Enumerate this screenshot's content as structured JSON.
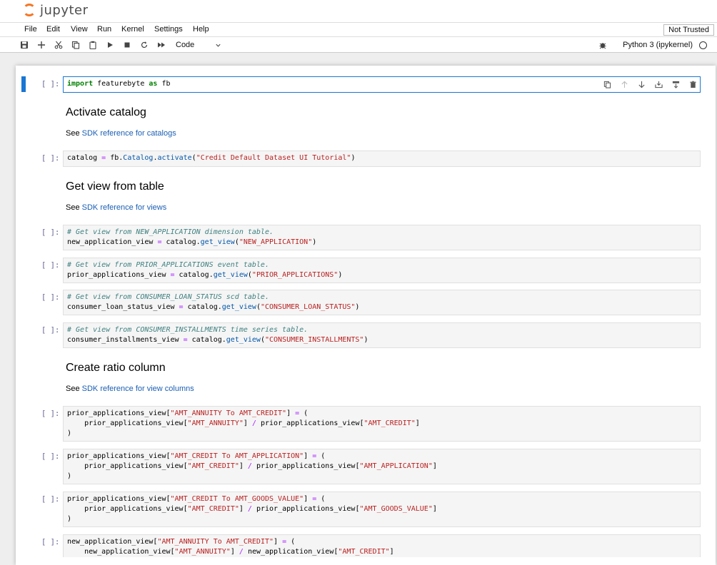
{
  "app": {
    "logo_text": "jupyter"
  },
  "menu": [
    "File",
    "Edit",
    "View",
    "Run",
    "Kernel",
    "Settings",
    "Help"
  ],
  "trusted_label": "Not Trusted",
  "toolbar": {
    "cell_type": "Code",
    "kernel_name": "Python 3 (ipykernel)"
  },
  "cells": {
    "c1": {
      "prompt": "[ ]:"
    },
    "h1": "Activate catalog",
    "p1": {
      "pre": "See ",
      "link": "SDK reference for catalogs"
    },
    "c2": {
      "prompt": "[ ]:"
    },
    "h2": "Get view from table",
    "p2": {
      "pre": "See ",
      "link": "SDK reference for views"
    },
    "c3": {
      "prompt": "[ ]:"
    },
    "c4": {
      "prompt": "[ ]:"
    },
    "c5": {
      "prompt": "[ ]:"
    },
    "c6": {
      "prompt": "[ ]:"
    },
    "h3": "Create ratio column",
    "p3": {
      "pre": "See ",
      "link": "SDK reference for view columns"
    },
    "c7": {
      "prompt": "[ ]:"
    },
    "c8": {
      "prompt": "[ ]:"
    },
    "c9": {
      "prompt": "[ ]:"
    },
    "c10": {
      "prompt": "[ ]:"
    }
  },
  "code": {
    "c1": {
      "kw1": "import",
      "mod": " featurebyte ",
      "kw2": "as",
      "alias": " fb"
    },
    "c2": {
      "a": "catalog ",
      "eq": "=",
      "b": " fb.",
      "cls": "Catalog",
      "dot": ".",
      "fn": "activate",
      "p1": "(",
      "s": "\"Credit Default Dataset UI Tutorial\"",
      "p2": ")"
    },
    "c3": {
      "cmt": "# Get view from NEW_APPLICATION dimension table.",
      "a": "new_application_view ",
      "eq": "=",
      "b": " catalog.",
      "fn": "get_view",
      "p1": "(",
      "s": "\"NEW_APPLICATION\"",
      "p2": ")"
    },
    "c4": {
      "cmt": "# Get view from PRIOR_APPLICATIONS event table.",
      "a": "prior_applications_view ",
      "eq": "=",
      "b": " catalog.",
      "fn": "get_view",
      "p1": "(",
      "s": "\"PRIOR_APPLICATIONS\"",
      "p2": ")"
    },
    "c5": {
      "cmt": "# Get view from CONSUMER_LOAN_STATUS scd table.",
      "a": "consumer_loan_status_view ",
      "eq": "=",
      "b": " catalog.",
      "fn": "get_view",
      "p1": "(",
      "s": "\"CONSUMER_LOAN_STATUS\"",
      "p2": ")"
    },
    "c6": {
      "cmt": "# Get view from CONSUMER_INSTALLMENTS time series table.",
      "a": "consumer_installments_view ",
      "eq": "=",
      "b": " catalog.",
      "fn": "get_view",
      "p1": "(",
      "s": "\"CONSUMER_INSTALLMENTS\"",
      "p2": ")"
    },
    "c7": {
      "v": "prior_applications_view",
      "k1": "\"AMT_ANNUITY To AMT_CREDIT\"",
      "ind": "    ",
      "v1": "prior_applications_view",
      "k2": "\"AMT_ANNUITY\"",
      "v2": "prior_applications_view",
      "k3": "\"AMT_CREDIT\""
    },
    "c8": {
      "v": "prior_applications_view",
      "k1": "\"AMT_CREDIT To AMT_APPLICATION\"",
      "ind": "    ",
      "v1": "prior_applications_view",
      "k2": "\"AMT_CREDIT\"",
      "v2": "prior_applications_view",
      "k3": "\"AMT_APPLICATION\""
    },
    "c9": {
      "v": "prior_applications_view",
      "k1": "\"AMT_CREDIT To AMT_GOODS_VALUE\"",
      "ind": "    ",
      "v1": "prior_applications_view",
      "k2": "\"AMT_CREDIT\"",
      "v2": "prior_applications_view",
      "k3": "\"AMT_GOODS_VALUE\""
    },
    "c10": {
      "v": "new_application_view",
      "k1": "\"AMT_ANNUITY To AMT_CREDIT\"",
      "ind": "    ",
      "v1": "new_application_view",
      "k2": "\"AMT_ANNUITY\"",
      "v2": "new_application_view",
      "k3": "\"AMT_CREDIT\""
    }
  },
  "colors": {
    "accent": "#1976d2",
    "logo_orange": "#f37726",
    "link": "#1a5fb4"
  }
}
